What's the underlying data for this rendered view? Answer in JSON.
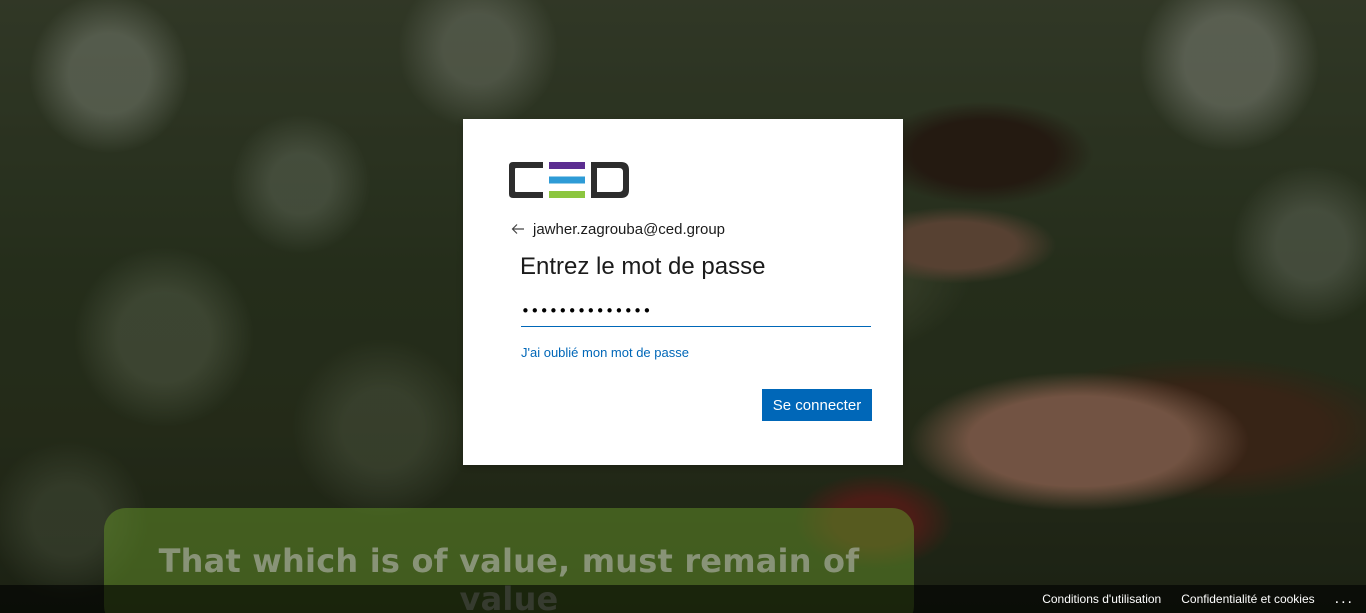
{
  "brand": {
    "logo_icon": "ced-logo",
    "colors": {
      "logo_dark": "#2d2d2d",
      "logo_purple": "#5c2d91",
      "logo_blue": "#2e9bd6",
      "logo_green": "#8cc63f",
      "accent": "#0067b8"
    }
  },
  "login": {
    "identity_email": "jawher.zagrouba@ced.group",
    "title": "Entrez le mot de passe",
    "password_value": "••••••••••••••",
    "forgot_link": "J'ai oublié mon mot de passe",
    "submit_label": "Se connecter"
  },
  "banner": {
    "text": "That which is of value, must remain of value"
  },
  "footer": {
    "terms": "Conditions d'utilisation",
    "privacy": "Confidentialité et cookies",
    "more": "..."
  }
}
